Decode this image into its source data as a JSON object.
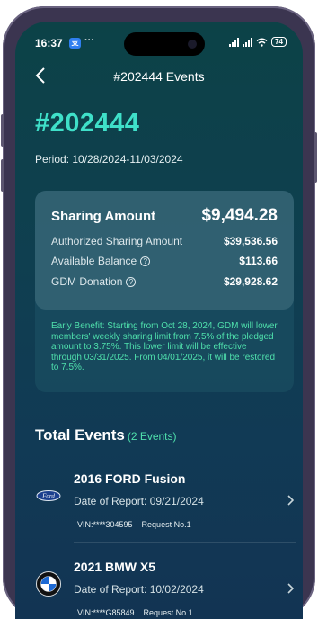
{
  "status_bar": {
    "time": "16:37",
    "app_badge": "支",
    "more": "···",
    "battery": "74"
  },
  "nav": {
    "back_icon": "chevron-left-icon",
    "title": "#202444 Events"
  },
  "header": {
    "number": "#202444",
    "period": "Period: 10/28/2024-11/03/2024"
  },
  "summary": {
    "sharing_amount_label": "Sharing Amount",
    "sharing_amount_value": "$9,494.28",
    "authorized_label": "Authorized Sharing Amount",
    "authorized_value": "$39,536.56",
    "balance_label": "Available Balance",
    "balance_value": "$113.66",
    "donation_label": "GDM Donation",
    "donation_value": "$29,928.62",
    "note": "Early Benefit: Starting from Oct 28, 2024, GDM will lower members' weekly sharing limit from 7.5% of the pledged amount to 3.75%. This lower limit will be effective through 03/31/2025. From 04/01/2025, it will be restored to 7.5%."
  },
  "events": {
    "title": "Total Events",
    "count": "(2 Events)",
    "items": [
      {
        "name": "2016 FORD Fusion",
        "date": "Date of Report: 09/21/2024",
        "vin": "VIN:****304595",
        "request": "Request No.1",
        "logo": "ford-logo"
      },
      {
        "name": "2021 BMW X5",
        "date": "Date of Report: 10/02/2024",
        "vin": "VIN:****G85849",
        "request": "Request No.1",
        "logo": "bmw-logo"
      }
    ]
  },
  "colors": {
    "accent_teal": "#3fe0c9",
    "note_green": "#4fe0ac",
    "background": "#0f3f50"
  }
}
